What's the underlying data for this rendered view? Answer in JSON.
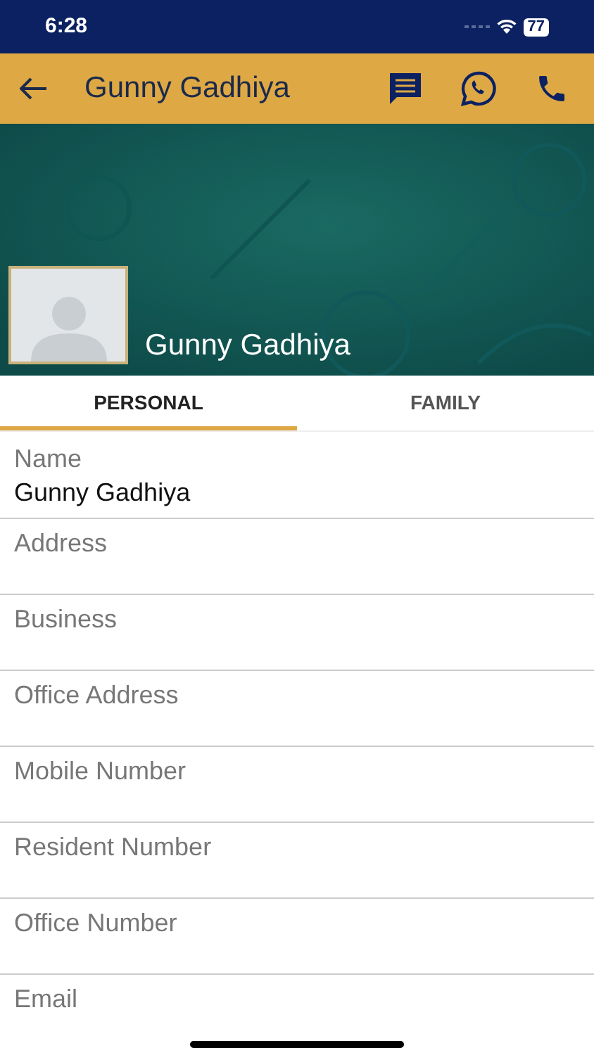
{
  "status_bar": {
    "time": "6:28",
    "battery": "77"
  },
  "app_bar": {
    "title": "Gunny Gadhiya"
  },
  "profile": {
    "name": "Gunny Gadhiya"
  },
  "tabs": [
    {
      "label": "PERSONAL",
      "selected": true
    },
    {
      "label": "FAMILY",
      "selected": false
    }
  ],
  "fields": [
    {
      "label": "Name",
      "value": "Gunny Gadhiya"
    },
    {
      "label": "Address"
    },
    {
      "label": "Business"
    },
    {
      "label": "Office Address"
    },
    {
      "label": "Mobile Number"
    },
    {
      "label": "Resident Number"
    },
    {
      "label": "Office Number"
    },
    {
      "label": "Email"
    }
  ]
}
